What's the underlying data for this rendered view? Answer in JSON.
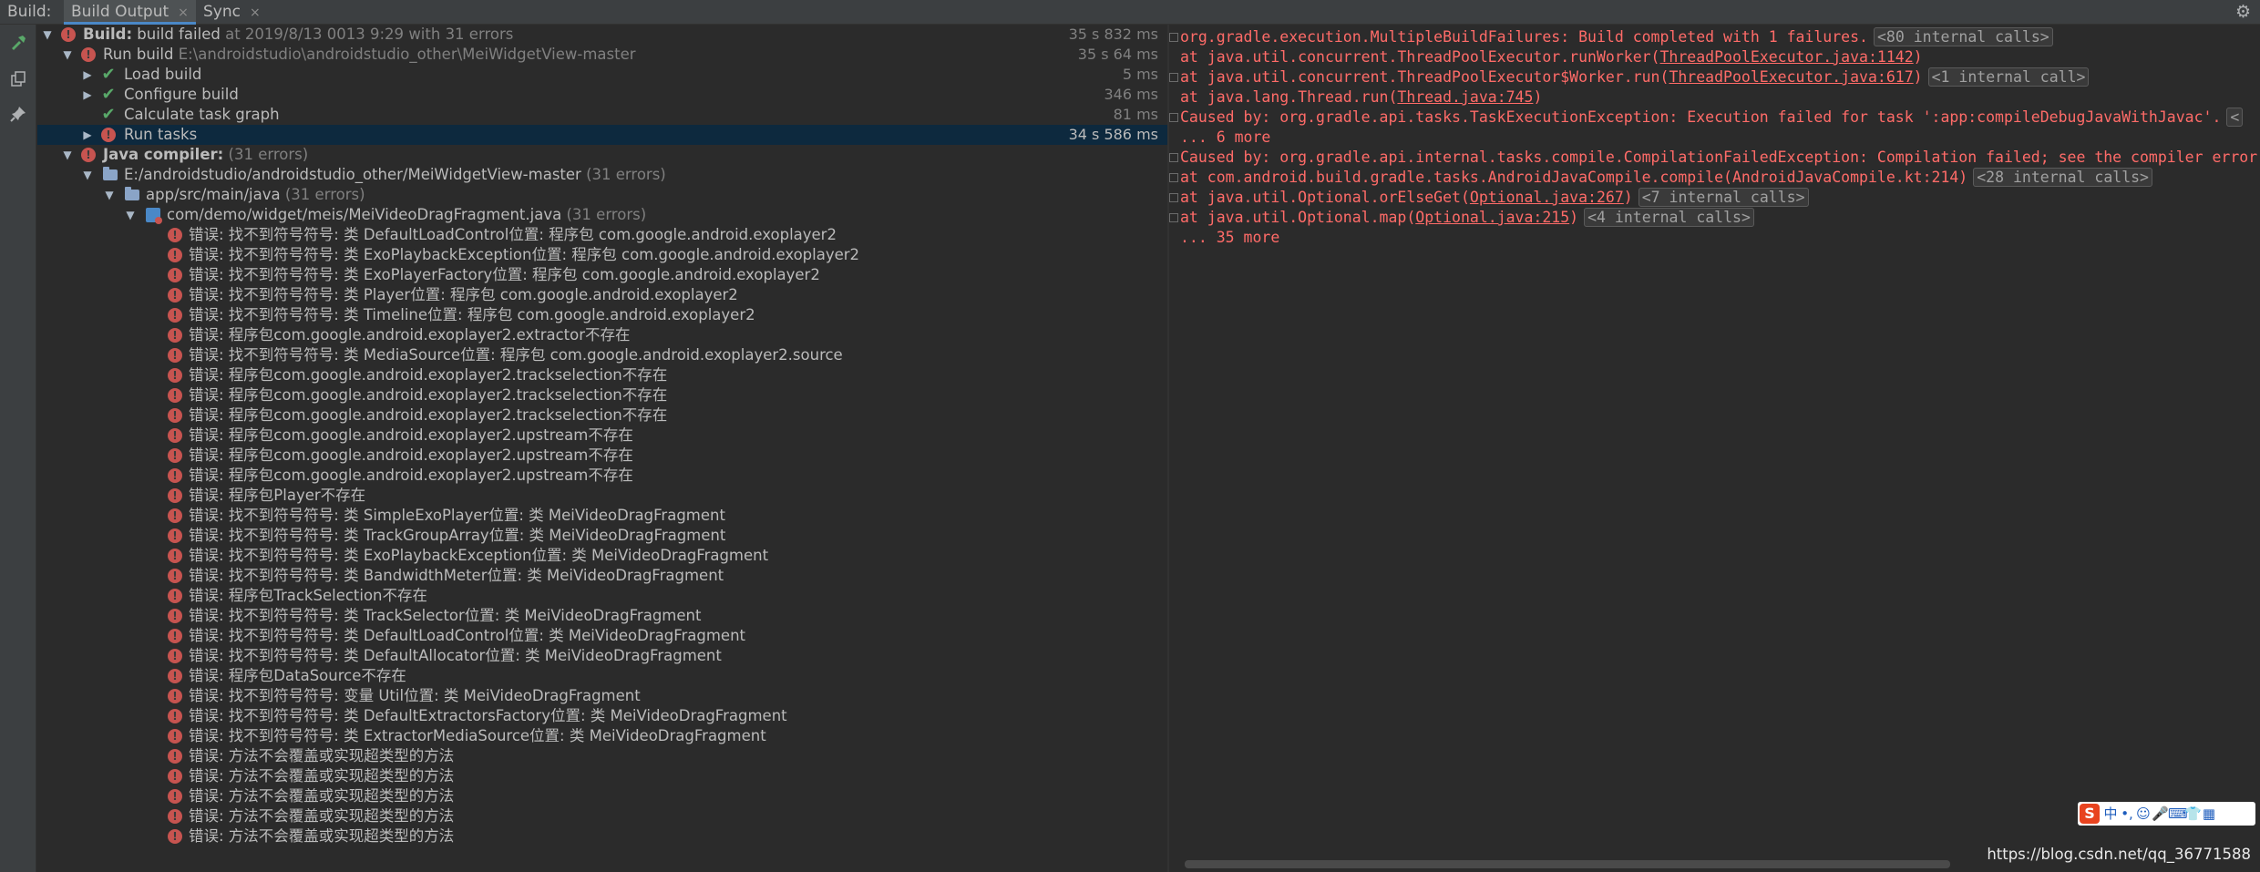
{
  "topbar": {
    "label": "Build:",
    "tabs": [
      "Build Output",
      "Sync"
    ],
    "close_glyph": "×",
    "settings_icon": "gear-icon"
  },
  "toolbar": [
    "hammer-icon",
    "copy-icon",
    "pin-icon"
  ],
  "tree": {
    "build": {
      "title": "Build:",
      "status": "build failed",
      "when": "at 2019/8/13 0013 9:29",
      "errors": "with 31 errors",
      "time": "35 s 832 ms"
    },
    "run_build": {
      "label": "Run build",
      "path": "E:\\androidstudio\\androidstudio_other\\MeiWidgetView-master",
      "time": "35 s 64 ms"
    },
    "steps": [
      {
        "label": "Load build",
        "time": "5 ms"
      },
      {
        "label": "Configure build",
        "time": "346 ms"
      },
      {
        "label": "Calculate task graph",
        "time": "81 ms"
      },
      {
        "label": "Run tasks",
        "time": "34 s 586 ms"
      }
    ],
    "java_compiler": {
      "label": "Java compiler:",
      "count": "(31 errors)"
    },
    "project": {
      "label": "E:/androidstudio/androidstudio_other/MeiWidgetView-master",
      "count": "(31 errors)"
    },
    "srcdir": {
      "label": "app/src/main/java",
      "count": "(31 errors)"
    },
    "file": {
      "label": "com/demo/widget/meis/MeiVideoDragFragment.java",
      "count": "(31 errors)"
    },
    "errors": [
      "错误: 找不到符号符号:   类 DefaultLoadControl位置: 程序包 com.google.android.exoplayer2",
      "错误: 找不到符号符号:   类 ExoPlaybackException位置: 程序包 com.google.android.exoplayer2",
      "错误: 找不到符号符号:   类 ExoPlayerFactory位置: 程序包 com.google.android.exoplayer2",
      "错误: 找不到符号符号:   类 Player位置: 程序包 com.google.android.exoplayer2",
      "错误: 找不到符号符号:   类 Timeline位置: 程序包 com.google.android.exoplayer2",
      "错误: 程序包com.google.android.exoplayer2.extractor不存在",
      "错误: 找不到符号符号:   类 MediaSource位置: 程序包 com.google.android.exoplayer2.source",
      "错误: 程序包com.google.android.exoplayer2.trackselection不存在",
      "错误: 程序包com.google.android.exoplayer2.trackselection不存在",
      "错误: 程序包com.google.android.exoplayer2.trackselection不存在",
      "错误: 程序包com.google.android.exoplayer2.upstream不存在",
      "错误: 程序包com.google.android.exoplayer2.upstream不存在",
      "错误: 程序包com.google.android.exoplayer2.upstream不存在",
      "错误: 程序包Player不存在",
      "错误: 找不到符号符号:   类 SimpleExoPlayer位置: 类 MeiVideoDragFragment",
      "错误: 找不到符号符号:   类 TrackGroupArray位置: 类 MeiVideoDragFragment",
      "错误: 找不到符号符号:   类 ExoPlaybackException位置: 类 MeiVideoDragFragment",
      "错误: 找不到符号符号:   类 BandwidthMeter位置: 类 MeiVideoDragFragment",
      "错误: 程序包TrackSelection不存在",
      "错误: 找不到符号符号:   类 TrackSelector位置: 类 MeiVideoDragFragment",
      "错误: 找不到符号符号:   类 DefaultLoadControl位置: 类 MeiVideoDragFragment",
      "错误: 找不到符号符号:   类 DefaultAllocator位置: 类 MeiVideoDragFragment",
      "错误: 程序包DataSource不存在",
      "错误: 找不到符号符号:   变量 Util位置: 类 MeiVideoDragFragment",
      "错误: 找不到符号符号:   类 DefaultExtractorsFactory位置: 类 MeiVideoDragFragment",
      "错误: 找不到符号符号:   类 ExtractorMediaSource位置: 类 MeiVideoDragFragment",
      "错误: 方法不会覆盖或实现超类型的方法",
      "错误: 方法不会覆盖或实现超类型的方法",
      "错误: 方法不会覆盖或实现超类型的方法",
      "错误: 方法不会覆盖或实现超类型的方法",
      "错误: 方法不会覆盖或实现超类型的方法"
    ]
  },
  "console": {
    "lines": [
      {
        "gutter": "⊟",
        "parts": [
          {
            "t": "org.gradle.execution.MultipleBuildFailures: Build completed with 1 failures."
          },
          {
            "c": "<80 internal calls>"
          }
        ]
      },
      {
        "gutter": "",
        "parts": [
          {
            "t": "    at java.util.concurrent.ThreadPoolExecutor.runWorker("
          },
          {
            "l": "ThreadPoolExecutor.java:1142"
          },
          {
            "t": ")"
          }
        ]
      },
      {
        "gutter": "⊞",
        "parts": [
          {
            "t": "    at java.util.concurrent.ThreadPoolExecutor$Worker.run("
          },
          {
            "l": "ThreadPoolExecutor.java:617"
          },
          {
            "t": ")"
          },
          {
            "c": "<1 internal call>"
          }
        ]
      },
      {
        "gutter": "",
        "parts": [
          {
            "t": "    at java.lang.Thread.run("
          },
          {
            "l": "Thread.java:745"
          },
          {
            "t": ")"
          }
        ]
      },
      {
        "gutter": "⊟",
        "parts": [
          {
            "t": "Caused by: org.gradle.api.tasks.TaskExecutionException: Execution failed for task ':app:compileDebugJavaWithJavac'."
          },
          {
            "c": "<"
          }
        ]
      },
      {
        "gutter": "",
        "parts": [
          {
            "t": "    ... 6 more"
          }
        ]
      },
      {
        "gutter": "⊟",
        "parts": [
          {
            "t": "Caused by: org.gradle.api.internal.tasks.compile.CompilationFailedException: Compilation failed; see the compiler error"
          }
        ]
      },
      {
        "gutter": "⊞",
        "parts": [
          {
            "t": "    at com.android.build.gradle.tasks.AndroidJavaCompile.compile(AndroidJavaCompile.kt:214)"
          },
          {
            "c": "<28 internal calls>"
          }
        ]
      },
      {
        "gutter": "⊞",
        "parts": [
          {
            "t": "    at java.util.Optional.orElseGet("
          },
          {
            "l": "Optional.java:267"
          },
          {
            "t": ")"
          },
          {
            "c": "<7 internal calls>"
          }
        ]
      },
      {
        "gutter": "⊞",
        "parts": [
          {
            "t": "    at java.util.Optional.map("
          },
          {
            "l": "Optional.java:215"
          },
          {
            "t": ")"
          },
          {
            "c": "<4 internal calls>"
          }
        ]
      },
      {
        "gutter": "",
        "parts": [
          {
            "t": "    ... 35 more"
          }
        ]
      }
    ]
  },
  "ime": {
    "logo": "S",
    "items": [
      "中",
      "•,",
      "☺",
      "🎤",
      "⌨",
      "👕",
      "▦"
    ]
  },
  "watermark": "https://blog.csdn.net/qq_36771588"
}
